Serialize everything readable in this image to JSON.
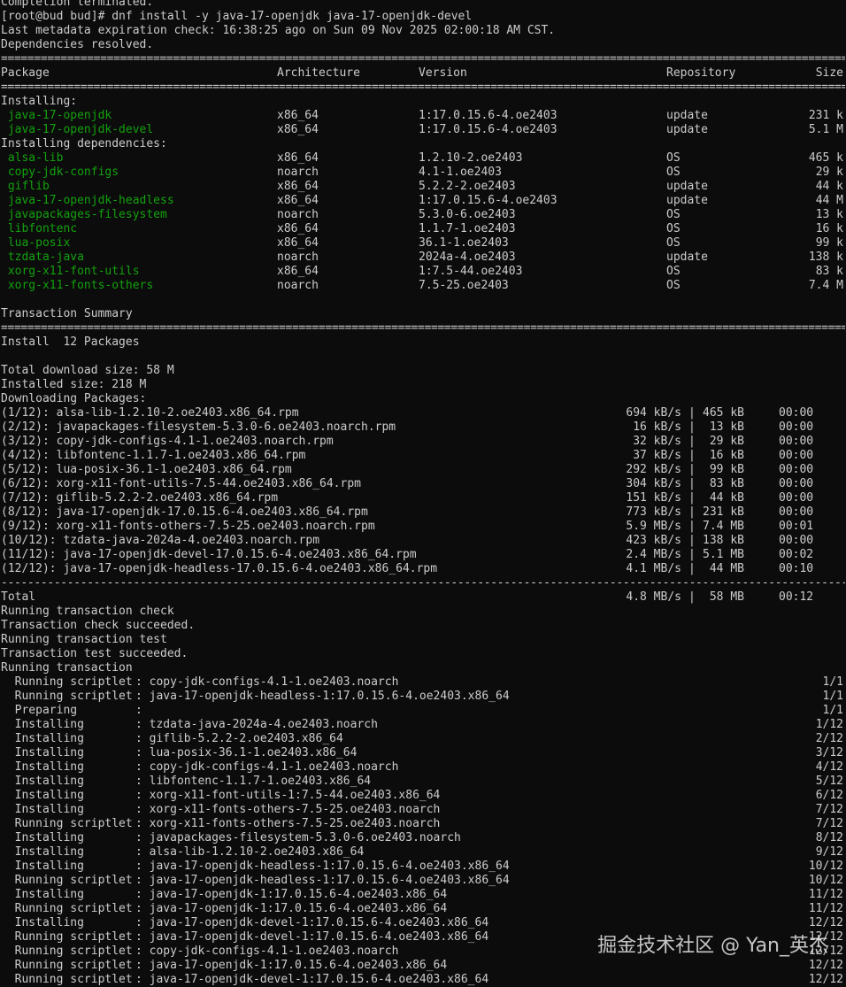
{
  "header_lines": [
    "Completion terminated.",
    "[root@bud bud]# dnf install -y java-17-openjdk java-17-openjdk-devel",
    "Last metadata expiration check: 16:38:25 ago on Sun 09 Nov 2025 02:00:18 AM CST.",
    "Dependencies resolved."
  ],
  "separator": "================================================================================================================================================================",
  "dash_separator": "----------------------------------------------------------------------------------------------------------------------------------------------------------------",
  "columns": {
    "package": "Package",
    "arch": "Architecture",
    "version": "Version",
    "repo": "Repository",
    "size": "Size"
  },
  "installing_label": "Installing:",
  "installing": [
    {
      "name": "java-17-openjdk",
      "arch": "x86_64",
      "version": "1:17.0.15.6-4.oe2403",
      "repo": "update",
      "size": "231 k"
    },
    {
      "name": "java-17-openjdk-devel",
      "arch": "x86_64",
      "version": "1:17.0.15.6-4.oe2403",
      "repo": "update",
      "size": "5.1 M"
    }
  ],
  "deps_label": "Installing dependencies:",
  "dependencies": [
    {
      "name": "alsa-lib",
      "arch": "x86_64",
      "version": "1.2.10-2.oe2403",
      "repo": "OS",
      "size": "465 k"
    },
    {
      "name": "copy-jdk-configs",
      "arch": "noarch",
      "version": "4.1-1.oe2403",
      "repo": "OS",
      "size": "29 k"
    },
    {
      "name": "giflib",
      "arch": "x86_64",
      "version": "5.2.2-2.oe2403",
      "repo": "update",
      "size": "44 k"
    },
    {
      "name": "java-17-openjdk-headless",
      "arch": "x86_64",
      "version": "1:17.0.15.6-4.oe2403",
      "repo": "update",
      "size": "44 M"
    },
    {
      "name": "javapackages-filesystem",
      "arch": "noarch",
      "version": "5.3.0-6.oe2403",
      "repo": "OS",
      "size": "13 k"
    },
    {
      "name": "libfontenc",
      "arch": "x86_64",
      "version": "1.1.7-1.oe2403",
      "repo": "OS",
      "size": "16 k"
    },
    {
      "name": "lua-posix",
      "arch": "x86_64",
      "version": "36.1-1.oe2403",
      "repo": "OS",
      "size": "99 k"
    },
    {
      "name": "tzdata-java",
      "arch": "noarch",
      "version": "2024a-4.oe2403",
      "repo": "update",
      "size": "138 k"
    },
    {
      "name": "xorg-x11-font-utils",
      "arch": "x86_64",
      "version": "1:7.5-44.oe2403",
      "repo": "OS",
      "size": "83 k"
    },
    {
      "name": "xorg-x11-fonts-others",
      "arch": "noarch",
      "version": "7.5-25.oe2403",
      "repo": "OS",
      "size": "7.4 M"
    }
  ],
  "summary_label": "Transaction Summary",
  "install_count": "Install  12 Packages",
  "totals": [
    "Total download size: 58 M",
    "Installed size: 218 M",
    "Downloading Packages:"
  ],
  "downloads": [
    {
      "file": "(1/12): alsa-lib-1.2.10-2.oe2403.x86_64.rpm",
      "rate": "694 kB/s",
      "size": "465 kB",
      "time": "00:00"
    },
    {
      "file": "(2/12): javapackages-filesystem-5.3.0-6.oe2403.noarch.rpm",
      "rate": "16 kB/s",
      "size": "13 kB",
      "time": "00:00"
    },
    {
      "file": "(3/12): copy-jdk-configs-4.1-1.oe2403.noarch.rpm",
      "rate": "32 kB/s",
      "size": "29 kB",
      "time": "00:00"
    },
    {
      "file": "(4/12): libfontenc-1.1.7-1.oe2403.x86_64.rpm",
      "rate": "37 kB/s",
      "size": "16 kB",
      "time": "00:00"
    },
    {
      "file": "(5/12): lua-posix-36.1-1.oe2403.x86_64.rpm",
      "rate": "292 kB/s",
      "size": "99 kB",
      "time": "00:00"
    },
    {
      "file": "(6/12): xorg-x11-font-utils-7.5-44.oe2403.x86_64.rpm",
      "rate": "304 kB/s",
      "size": "83 kB",
      "time": "00:00"
    },
    {
      "file": "(7/12): giflib-5.2.2-2.oe2403.x86_64.rpm",
      "rate": "151 kB/s",
      "size": "44 kB",
      "time": "00:00"
    },
    {
      "file": "(8/12): java-17-openjdk-17.0.15.6-4.oe2403.x86_64.rpm",
      "rate": "773 kB/s",
      "size": "231 kB",
      "time": "00:00"
    },
    {
      "file": "(9/12): xorg-x11-fonts-others-7.5-25.oe2403.noarch.rpm",
      "rate": "5.9 MB/s",
      "size": "7.4 MB",
      "time": "00:01"
    },
    {
      "file": "(10/12): tzdata-java-2024a-4.oe2403.noarch.rpm",
      "rate": "423 kB/s",
      "size": "138 kB",
      "time": "00:00"
    },
    {
      "file": "(11/12): java-17-openjdk-devel-17.0.15.6-4.oe2403.x86_64.rpm",
      "rate": "2.4 MB/s",
      "size": "5.1 MB",
      "time": "00:02"
    },
    {
      "file": "(12/12): java-17-openjdk-headless-17.0.15.6-4.oe2403.x86_64.rpm",
      "rate": "4.1 MB/s",
      "size": "44 MB",
      "time": "00:10"
    }
  ],
  "total_row": {
    "label": "Total",
    "rate": "4.8 MB/s",
    "size": "58 MB",
    "time": "00:12"
  },
  "status_lines": [
    "Running transaction check",
    "Transaction check succeeded.",
    "Running transaction test",
    "Transaction test succeeded.",
    "Running transaction"
  ],
  "transaction": [
    {
      "action": "Running scriptlet",
      "pkg": "copy-jdk-configs-4.1-1.oe2403.noarch",
      "prog": "1/1"
    },
    {
      "action": "Running scriptlet",
      "pkg": "java-17-openjdk-headless-1:17.0.15.6-4.oe2403.x86_64",
      "prog": "1/1"
    },
    {
      "action": "Preparing",
      "pkg": "",
      "prog": "1/1"
    },
    {
      "action": "Installing",
      "pkg": "tzdata-java-2024a-4.oe2403.noarch",
      "prog": "1/12"
    },
    {
      "action": "Installing",
      "pkg": "giflib-5.2.2-2.oe2403.x86_64",
      "prog": "2/12"
    },
    {
      "action": "Installing",
      "pkg": "lua-posix-36.1-1.oe2403.x86_64",
      "prog": "3/12"
    },
    {
      "action": "Installing",
      "pkg": "copy-jdk-configs-4.1-1.oe2403.noarch",
      "prog": "4/12"
    },
    {
      "action": "Installing",
      "pkg": "libfontenc-1.1.7-1.oe2403.x86_64",
      "prog": "5/12"
    },
    {
      "action": "Installing",
      "pkg": "xorg-x11-font-utils-1:7.5-44.oe2403.x86_64",
      "prog": "6/12"
    },
    {
      "action": "Installing",
      "pkg": "xorg-x11-fonts-others-7.5-25.oe2403.noarch",
      "prog": "7/12"
    },
    {
      "action": "Running scriptlet",
      "pkg": "xorg-x11-fonts-others-7.5-25.oe2403.noarch",
      "prog": "7/12"
    },
    {
      "action": "Installing",
      "pkg": "javapackages-filesystem-5.3.0-6.oe2403.noarch",
      "prog": "8/12"
    },
    {
      "action": "Installing",
      "pkg": "alsa-lib-1.2.10-2.oe2403.x86_64",
      "prog": "9/12"
    },
    {
      "action": "Installing",
      "pkg": "java-17-openjdk-headless-1:17.0.15.6-4.oe2403.x86_64",
      "prog": "10/12"
    },
    {
      "action": "Running scriptlet",
      "pkg": "java-17-openjdk-headless-1:17.0.15.6-4.oe2403.x86_64",
      "prog": "10/12"
    },
    {
      "action": "Installing",
      "pkg": "java-17-openjdk-1:17.0.15.6-4.oe2403.x86_64",
      "prog": "11/12"
    },
    {
      "action": "Running scriptlet",
      "pkg": "java-17-openjdk-1:17.0.15.6-4.oe2403.x86_64",
      "prog": "11/12"
    },
    {
      "action": "Installing",
      "pkg": "java-17-openjdk-devel-1:17.0.15.6-4.oe2403.x86_64",
      "prog": "12/12"
    },
    {
      "action": "Running scriptlet",
      "pkg": "java-17-openjdk-devel-1:17.0.15.6-4.oe2403.x86_64",
      "prog": "12/12"
    },
    {
      "action": "Running scriptlet",
      "pkg": "copy-jdk-configs-4.1-1.oe2403.noarch",
      "prog": "12/12"
    },
    {
      "action": "Running scriptlet",
      "pkg": "java-17-openjdk-1:17.0.15.6-4.oe2403.x86_64",
      "prog": "12/12"
    },
    {
      "action": "Running scriptlet",
      "pkg": "java-17-openjdk-devel-1:17.0.15.6-4.oe2403.x86_64",
      "prog": "12/12"
    }
  ],
  "watermark": "掘金技术社区 @ Yan_英杰",
  "colors": {
    "background": "#0c0c0c",
    "text": "#cccccc",
    "package_name": "#13a10e"
  }
}
